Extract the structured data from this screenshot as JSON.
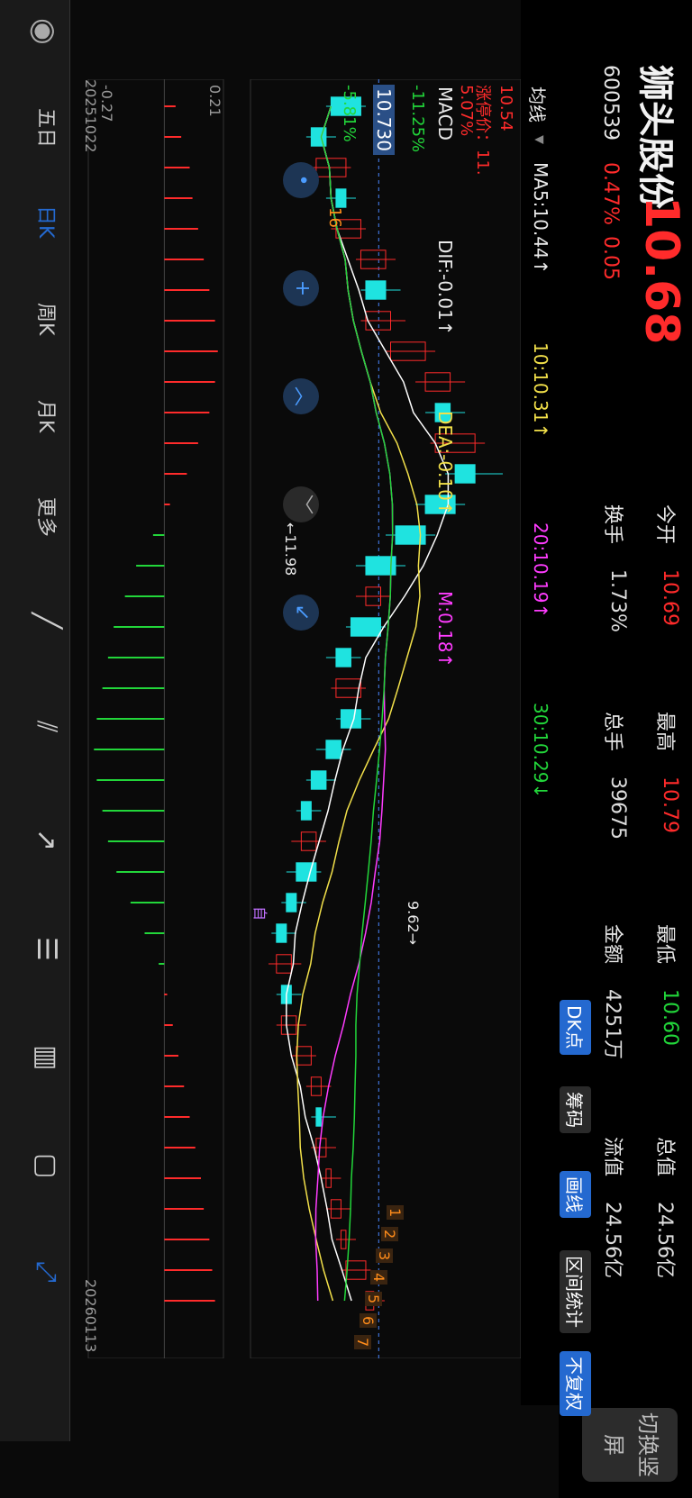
{
  "stock": {
    "name": "狮头股份",
    "code": "600539",
    "price": "10.68",
    "change_pct": "0.47%",
    "change": "0.05"
  },
  "quote": [
    {
      "label": "今开",
      "value": "10.69",
      "color": "#ff2b2b"
    },
    {
      "label": "最高",
      "value": "10.79",
      "color": "#ff2b2b"
    },
    {
      "label": "最低",
      "value": "10.60",
      "color": "#22d63a"
    },
    {
      "label": "总值",
      "value": "24.56亿",
      "color": "#e6e6e6"
    },
    {
      "label": "换手",
      "value": "1.73%",
      "color": "#e6e6e6"
    },
    {
      "label": "总手",
      "value": "39675",
      "color": "#e6e6e6"
    },
    {
      "label": "金额",
      "value": "4251万",
      "color": "#e6e6e6"
    },
    {
      "label": "流值",
      "value": "24.56亿",
      "color": "#e6e6e6"
    }
  ],
  "portrait_button": "切换竖屏",
  "buttons": {
    "dk": "DK点",
    "chip": "筹码",
    "draw": "画线",
    "range": "区间统计",
    "adjust": "不复权"
  },
  "ma": {
    "selector": "均线",
    "ma5": "MA5:10.44↑",
    "ma10": "10:10.31↑",
    "ma20": "20:10.19↑",
    "ma30": "30:10.29↓"
  },
  "price_axis": {
    "top": "10.54",
    "limit": "涨停价：11.",
    "pct_top": "5.07%",
    "current_box": "10.730",
    "pct_mid1": "-5.81%",
    "pct_mid2": "-11.25%",
    "sixteen": "16"
  },
  "annotations": {
    "high": "←11.98",
    "low": "9.62→",
    "self": "自",
    "markers": [
      "1",
      "2",
      "3",
      "4",
      "5",
      "6",
      "7"
    ]
  },
  "macd": {
    "selector": "MACD",
    "dif": "DIF:-0.01↑",
    "dea": "DEA:-0.10↑",
    "m": "M:0.18↑",
    "top": "0.21",
    "bottom": "-0.27"
  },
  "dates": {
    "start": "20251022",
    "end": "20260113"
  },
  "toolbar": [
    "五日",
    "日K",
    "周K",
    "月K",
    "更多"
  ],
  "colors": {
    "up": "#ff2b2b",
    "down": "#1fe3e0",
    "ma5": "#ffffff",
    "ma10": "#f2e04a",
    "ma20": "#ff3cff",
    "ma30": "#22d63a",
    "accent_blue": "#2469d0"
  },
  "chart_data": {
    "type": "candlestick",
    "x_range": [
      "20251022",
      "20260113"
    ],
    "series": [
      {
        "name": "MA5",
        "value": "10.44"
      },
      {
        "name": "10",
        "value": "10.31"
      },
      {
        "name": "20",
        "value": "10.19"
      },
      {
        "name": "30",
        "value": "10.29"
      }
    ],
    "candles": [
      [
        10.55,
        10.25,
        10.6,
        10.2
      ],
      [
        10.2,
        10.05,
        10.3,
        10.0
      ],
      [
        10.1,
        10.4,
        10.45,
        10.05
      ],
      [
        10.4,
        10.3,
        10.5,
        10.2
      ],
      [
        10.3,
        10.55,
        10.6,
        10.25
      ],
      [
        10.55,
        10.8,
        10.9,
        10.5
      ],
      [
        10.8,
        10.6,
        10.95,
        10.55
      ],
      [
        10.6,
        10.85,
        11.0,
        10.55
      ],
      [
        10.85,
        11.2,
        11.3,
        10.8
      ],
      [
        11.2,
        11.45,
        11.6,
        11.1
      ],
      [
        11.45,
        11.3,
        11.6,
        11.2
      ],
      [
        11.3,
        11.7,
        11.8,
        11.25
      ],
      [
        11.7,
        11.5,
        11.98,
        11.4
      ],
      [
        11.5,
        11.2,
        11.6,
        11.1
      ],
      [
        11.2,
        10.9,
        11.3,
        10.8
      ],
      [
        10.9,
        10.6,
        11.0,
        10.5
      ],
      [
        10.6,
        10.75,
        10.85,
        10.5
      ],
      [
        10.75,
        10.45,
        10.8,
        10.4
      ],
      [
        10.45,
        10.3,
        10.55,
        10.2
      ],
      [
        10.3,
        10.55,
        10.6,
        10.25
      ],
      [
        10.55,
        10.35,
        10.65,
        10.3
      ],
      [
        10.35,
        10.2,
        10.45,
        10.1
      ],
      [
        10.2,
        10.05,
        10.3,
        10.0
      ],
      [
        10.05,
        9.95,
        10.15,
        9.9
      ],
      [
        9.95,
        10.1,
        10.2,
        9.85
      ],
      [
        10.1,
        9.9,
        10.15,
        9.8
      ],
      [
        9.9,
        9.8,
        10.0,
        9.75
      ],
      [
        9.8,
        9.7,
        9.9,
        9.65
      ],
      [
        9.7,
        9.85,
        9.95,
        9.62
      ],
      [
        9.85,
        9.75,
        9.95,
        9.7
      ],
      [
        9.75,
        9.9,
        10.0,
        9.7
      ],
      [
        9.9,
        10.05,
        10.1,
        9.85
      ],
      [
        10.05,
        10.15,
        10.25,
        10.0
      ],
      [
        10.15,
        10.1,
        10.3,
        10.05
      ],
      [
        10.1,
        10.2,
        10.3,
        10.05
      ],
      [
        10.2,
        10.25,
        10.35,
        10.15
      ],
      [
        10.25,
        10.35,
        10.45,
        10.2
      ],
      [
        10.35,
        10.4,
        10.5,
        10.3
      ],
      [
        10.4,
        10.6,
        10.65,
        10.35
      ],
      [
        10.6,
        10.68,
        10.79,
        10.6
      ]
    ],
    "macd_bars": [
      0.04,
      0.06,
      0.09,
      0.1,
      0.12,
      0.14,
      0.16,
      0.18,
      0.19,
      0.18,
      0.16,
      0.12,
      0.08,
      0.02,
      -0.04,
      -0.1,
      -0.14,
      -0.18,
      -0.2,
      -0.22,
      -0.24,
      -0.25,
      -0.24,
      -0.22,
      -0.2,
      -0.17,
      -0.12,
      -0.07,
      -0.02,
      0.01,
      0.03,
      0.05,
      0.07,
      0.09,
      0.11,
      0.13,
      0.14,
      0.16,
      0.17,
      0.18
    ],
    "macd_range": [
      -0.27,
      0.21
    ]
  }
}
